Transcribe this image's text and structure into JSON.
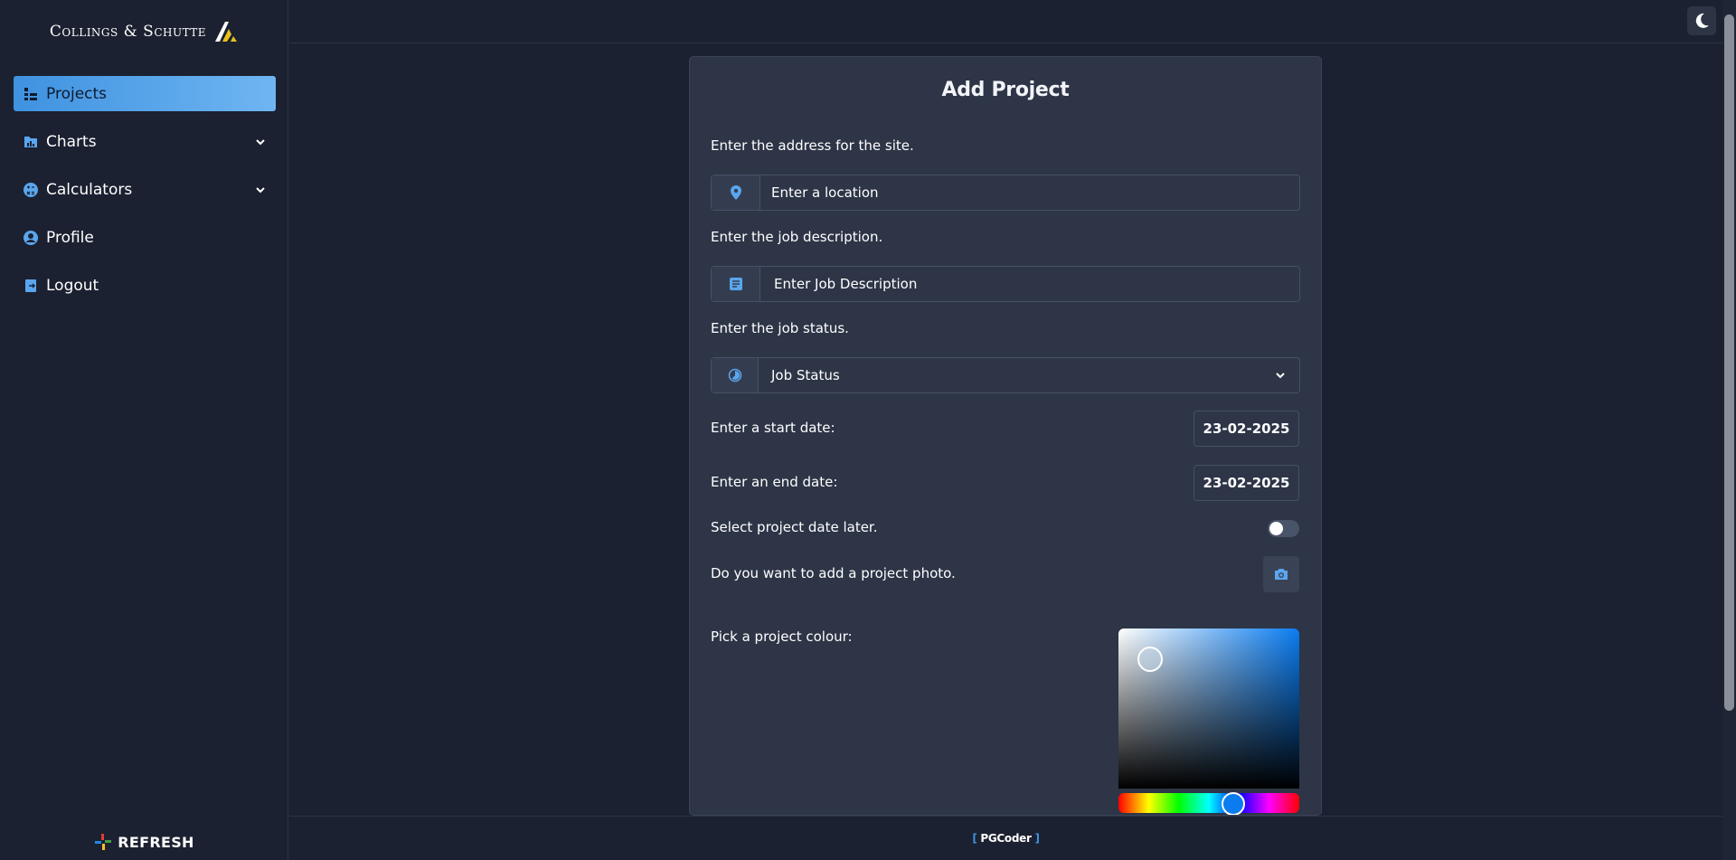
{
  "brand": {
    "name": "Collings & Schutte"
  },
  "sidebar": {
    "items": [
      {
        "label": "Projects",
        "icon": "projects-icon",
        "active": true
      },
      {
        "label": "Charts",
        "icon": "chart-icon",
        "expandable": true
      },
      {
        "label": "Calculators",
        "icon": "calculator-icon",
        "expandable": true
      },
      {
        "label": "Profile",
        "icon": "profile-icon"
      },
      {
        "label": "Logout",
        "icon": "logout-icon"
      }
    ],
    "refresh_label": "REFRESH"
  },
  "form": {
    "title": "Add Project",
    "address": {
      "label": "Enter the address for the site.",
      "placeholder": "Enter a location"
    },
    "description": {
      "label": "Enter the job description.",
      "placeholder": "Enter Job Description"
    },
    "status": {
      "label": "Enter the job status.",
      "selected": "Job Status"
    },
    "start_date": {
      "label": "Enter a start date:",
      "value": "23-02-2025"
    },
    "end_date": {
      "label": "Enter an end date:",
      "value": "23-02-2025"
    },
    "date_later": {
      "label": "Select project date later.",
      "on": false
    },
    "photo": {
      "label": "Do you want to add a project photo."
    },
    "colour": {
      "label": "Pick a project colour:",
      "value": "#0a7cf0"
    }
  },
  "footer": {
    "brand": "PGCoder"
  },
  "colors": {
    "accent": "#3f92e0",
    "background": "#1b2130",
    "card": "#2d3547"
  }
}
